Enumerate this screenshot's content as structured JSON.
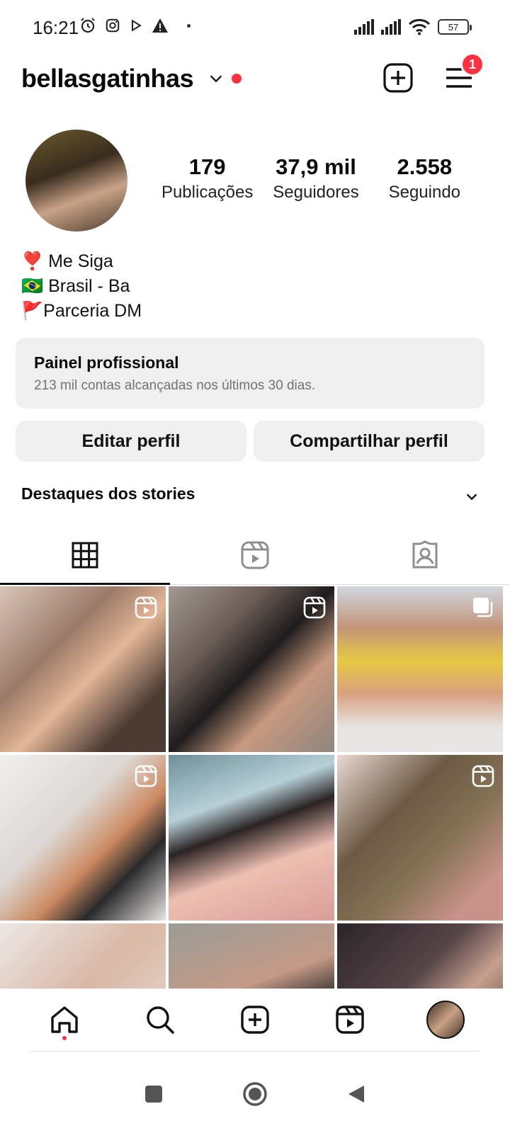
{
  "status_bar": {
    "time": "16:21",
    "battery": "57"
  },
  "header": {
    "username": "bellasgatinhas",
    "menu_badge": "1"
  },
  "profile": {
    "stats": [
      {
        "value": "179",
        "label": "Publicações"
      },
      {
        "value": "37,9 mil",
        "label": "Seguidores"
      },
      {
        "value": "2.558",
        "label": "Seguindo"
      }
    ],
    "bio": [
      {
        "emoji": "❣️",
        "text": " Me Siga"
      },
      {
        "emoji": "🇧🇷",
        "text": " Brasil - Ba"
      },
      {
        "emoji": "🚩",
        "text": "Parceria DM"
      }
    ]
  },
  "panel": {
    "title": "Painel profissional",
    "subtitle": "213 mil contas alcançadas nos últimos 30 dias."
  },
  "actions": {
    "edit": "Editar perfil",
    "share": "Compartilhar perfil"
  },
  "highlights": {
    "title": "Destaques dos stories"
  },
  "tabs": [
    {
      "icon": "grid-icon",
      "active": true
    },
    {
      "icon": "reels-icon",
      "active": false
    },
    {
      "icon": "tagged-icon",
      "active": false
    }
  ],
  "grid": [
    {
      "type": "reel"
    },
    {
      "type": "reel"
    },
    {
      "type": "carousel"
    },
    {
      "type": "reel"
    },
    {
      "type": "photo"
    },
    {
      "type": "reel"
    },
    {
      "type": "photo"
    },
    {
      "type": "photo"
    },
    {
      "type": "photo"
    }
  ],
  "colors": {
    "accent_red": "#ff3040",
    "button_bg": "#efefef",
    "muted_text": "#737373"
  }
}
